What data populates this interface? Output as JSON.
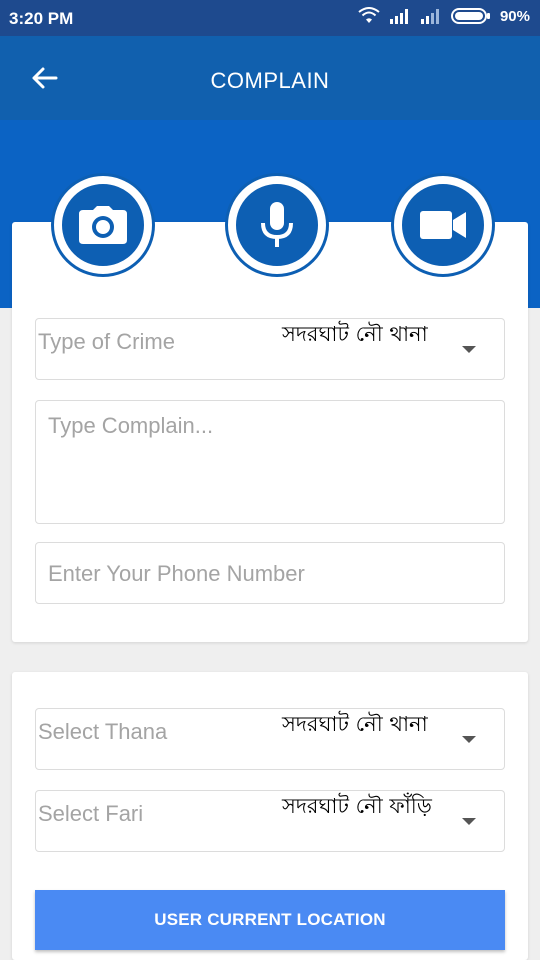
{
  "status_bar": {
    "time": "3:20 PM",
    "battery": "90%"
  },
  "header": {
    "title": "COMPLAIN"
  },
  "media_buttons": [
    "camera-icon",
    "microphone-icon",
    "video-icon"
  ],
  "form": {
    "crime_type": {
      "label": "Type of Crime",
      "value": "সদরঘাট নৌ থানা"
    },
    "complain": {
      "placeholder": "Type Complain..."
    },
    "phone": {
      "placeholder": "Enter Your Phone Number"
    }
  },
  "location_form": {
    "thana": {
      "label": "Select Thana",
      "value": "সদরঘাট নৌ থানা"
    },
    "fari": {
      "label": "Select Fari",
      "value": "সদরঘাট নৌ ফাঁড়ি"
    },
    "location_button": "USER CURRENT LOCATION"
  },
  "colors": {
    "header": "#1160ae",
    "status_bar": "#1e4a8e",
    "accent_button": "#4a8af3",
    "icon_circle": "#0d5fb3"
  }
}
